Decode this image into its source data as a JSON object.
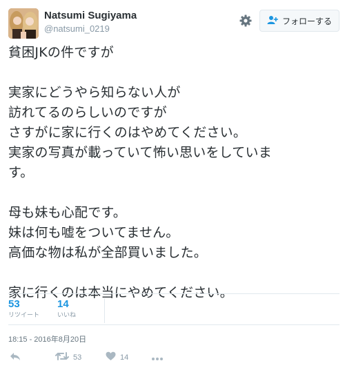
{
  "user": {
    "display_name": "Natsumi Sugiyama",
    "handle": "@natsumi_0219"
  },
  "follow_button": {
    "label": "フォローする"
  },
  "tweet": {
    "lines": [
      "貧困JKの件ですが",
      "",
      "実家にどうやら知らない人が",
      "訪れてるのらしいのですが",
      "さすがに家に行くのはやめてください。",
      "実家の写真が載っていて怖い思いをしていま",
      "す。",
      "",
      "母も妹も心配です。",
      "妹は何も嘘をついてません。",
      "高価な物は私が全部買いました。",
      "",
      "家に行くのは本当にやめてください。"
    ]
  },
  "stats": {
    "retweets": {
      "count": "53",
      "label": "リツイート"
    },
    "likes": {
      "count": "14",
      "label": "いいね"
    }
  },
  "timestamp": "18:15 - 2016年8月20日",
  "actions": {
    "retweet_count": "53",
    "like_count": "14"
  },
  "colors": {
    "accent": "#1b95e0",
    "muted": "#8899a6",
    "text": "#292f33",
    "border": "#e1e8ed"
  },
  "icons": [
    "gear-icon",
    "follow-person-icon",
    "reply-icon",
    "retweet-icon",
    "heart-icon",
    "more-icon"
  ]
}
